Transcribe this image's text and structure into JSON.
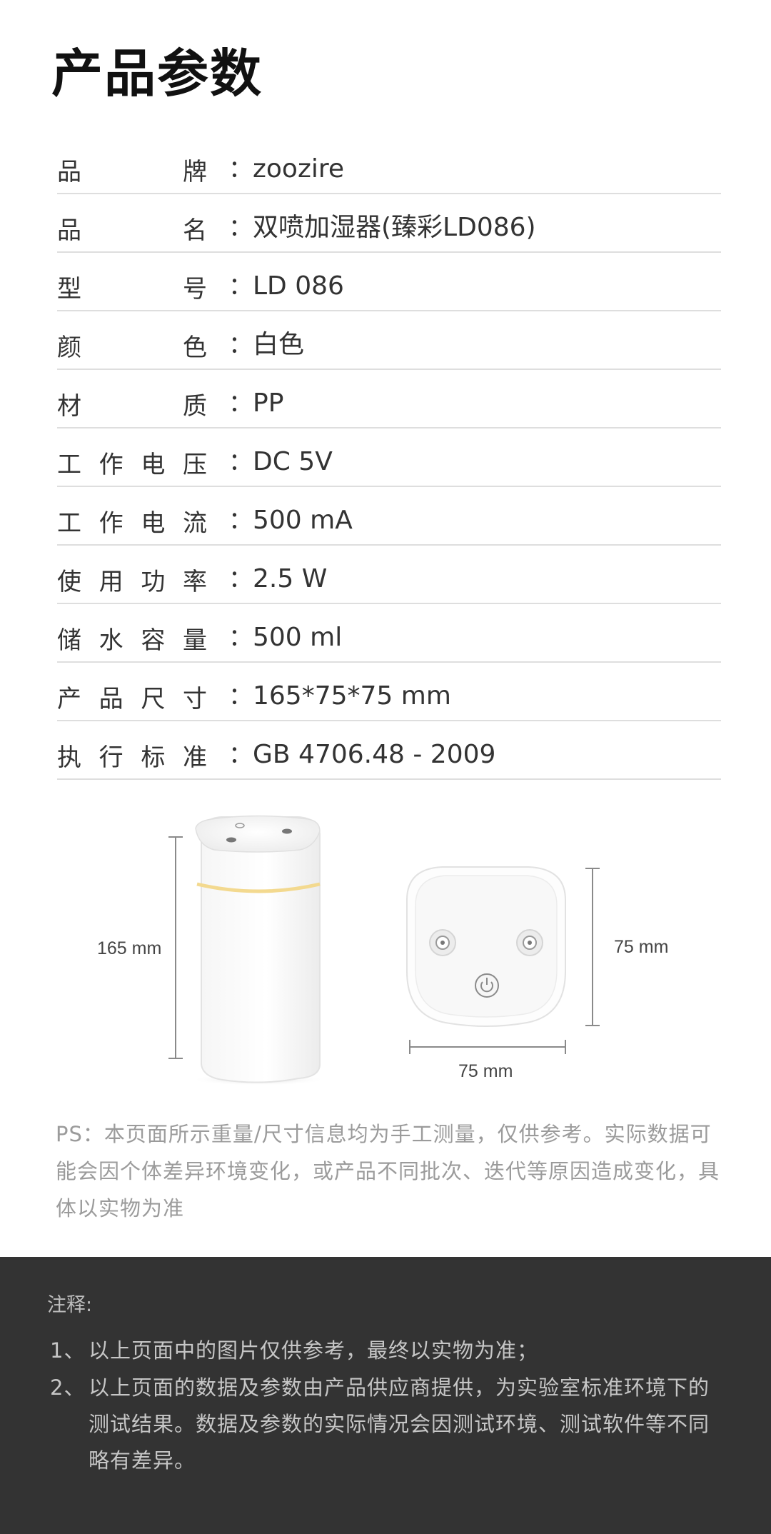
{
  "page_title": "产品参数",
  "params": [
    {
      "label": [
        "品",
        "牌"
      ],
      "value": "zoozire"
    },
    {
      "label": [
        "品",
        "名"
      ],
      "value": "双喷加湿器(臻彩LD086)"
    },
    {
      "label": [
        "型",
        "号"
      ],
      "value": "LD 086"
    },
    {
      "label": [
        "颜",
        "色"
      ],
      "value": "白色"
    },
    {
      "label": [
        "材",
        "质"
      ],
      "value": "PP"
    },
    {
      "label": [
        "工",
        "作",
        "电",
        "压"
      ],
      "value": "DC 5V"
    },
    {
      "label": [
        "工",
        "作",
        "电",
        "流"
      ],
      "value": "500 mA"
    },
    {
      "label": [
        "使",
        "用",
        "功",
        "率"
      ],
      "value": "2.5 W"
    },
    {
      "label": [
        "储",
        "水",
        "容",
        "量"
      ],
      "value": "500 ml"
    },
    {
      "label": [
        "产",
        "品",
        "尺",
        "寸"
      ],
      "value": "165*75*75 mm"
    },
    {
      "label": [
        "执",
        "行",
        "标",
        "准"
      ],
      "value": "GB 4706.48 - 2009"
    }
  ],
  "separator": "：",
  "dimensions": {
    "height": "165 mm",
    "depth": "75 mm",
    "width": "75 mm"
  },
  "ps_note": "PS：本页面所示重量/尺寸信息均为手工测量，仅供参考。实际数据可能会因个体差异环境变化，或产品不同批次、迭代等原因造成变化，具体以实物为准",
  "footer": {
    "title": "注释:",
    "notes": [
      {
        "num": "1、",
        "text": "以上页面中的图片仅供参考，最终以实物为准；"
      },
      {
        "num": "2、",
        "text": "以上页面的数据及参数由产品供应商提供，为实验室标准环境下的测试结果。数据及参数的实际情况会因测试环境、测试软件等不同略有差异。"
      }
    ]
  }
}
